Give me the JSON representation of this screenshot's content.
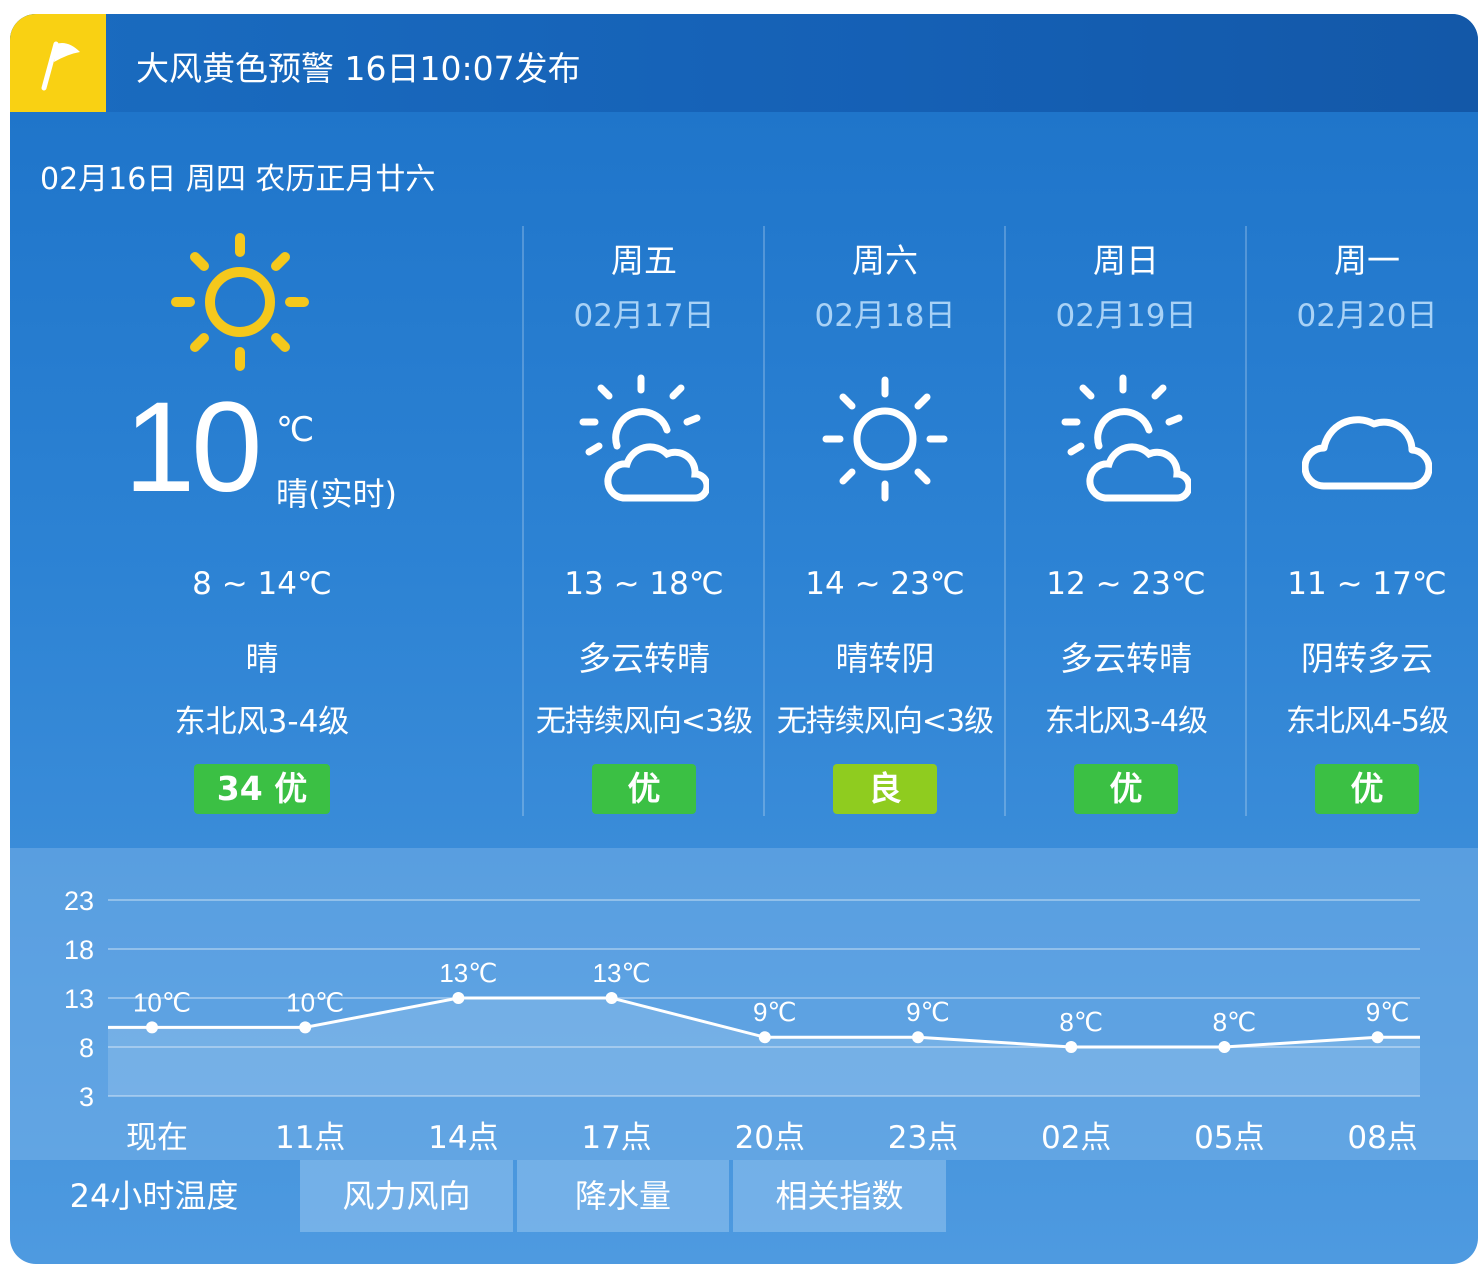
{
  "alert": {
    "text": "大风黄色预警 16日10:07发布",
    "flag_color": "#f9d113"
  },
  "date_line": "02月16日 周四 农历正月廿六",
  "today": {
    "icon": "sun-icon",
    "temp": "10",
    "unit": "℃",
    "condition": "晴(实时)",
    "range": "8 ~ 14℃",
    "weather": "晴",
    "wind": "东北风3-4级",
    "aqi": "34 优"
  },
  "forecast": [
    {
      "weekday": "周五",
      "date": "02月17日",
      "icon": "partly-cloudy-icon",
      "range": "13 ~ 18℃",
      "condition": "多云转晴",
      "wind": "无持续风向<3级",
      "aqi": "优",
      "aqi_color": "#3bc044"
    },
    {
      "weekday": "周六",
      "date": "02月18日",
      "icon": "sun-icon",
      "range": "14 ~ 23℃",
      "condition": "晴转阴",
      "wind": "无持续风向<3级",
      "aqi": "良",
      "aqi_color": "#8fcc1f"
    },
    {
      "weekday": "周日",
      "date": "02月19日",
      "icon": "partly-cloudy-icon",
      "range": "12 ~ 23℃",
      "condition": "多云转晴",
      "wind": "东北风3-4级",
      "aqi": "优",
      "aqi_color": "#3bc044"
    },
    {
      "weekday": "周一",
      "date": "02月20日",
      "icon": "cloud-icon",
      "range": "11 ~ 17℃",
      "condition": "阴转多云",
      "wind": "东北风4-5级",
      "aqi": "优",
      "aqi_color": "#3bc044"
    }
  ],
  "chart_data": {
    "type": "line",
    "categories": [
      "现在",
      "11点",
      "14点",
      "17点",
      "20点",
      "23点",
      "02点",
      "05点",
      "08点"
    ],
    "values": [
      10,
      10,
      13,
      13,
      9,
      9,
      8,
      8,
      9
    ],
    "labels": [
      "10℃",
      "10℃",
      "13℃",
      "13℃",
      "9℃",
      "9℃",
      "8℃",
      "8℃",
      "9℃"
    ],
    "y_ticks": [
      23,
      18,
      13,
      8,
      3
    ],
    "ylim": [
      3,
      23
    ],
    "grid": true
  },
  "tabs": [
    "24小时温度",
    "风力风向",
    "降水量",
    "相关指数"
  ],
  "colors": {
    "accent": "#1c72c8",
    "good": "#3bc044",
    "fair": "#8fcc1f",
    "sun": "#f5c81c"
  }
}
